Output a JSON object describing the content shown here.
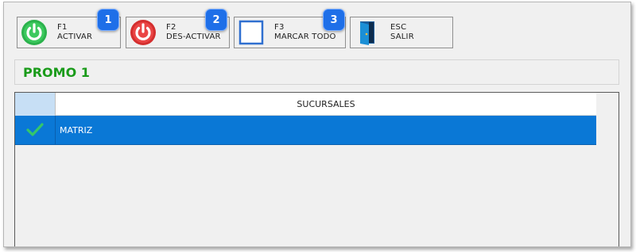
{
  "toolbar": {
    "activar": {
      "key": "F1",
      "label": "ACTIVAR",
      "icon": "power-green-icon",
      "color": "#2bb24c"
    },
    "desactivar": {
      "key": "F2",
      "label": "DES-ACTIVAR",
      "icon": "power-red-icon",
      "color": "#e03a3a"
    },
    "marcar": {
      "key": "F3",
      "label": "MARCAR TODO",
      "icon": "checkbox-empty-icon",
      "color": "#2f6fd0"
    },
    "salir": {
      "key": "ESC",
      "label": "SALIR",
      "icon": "door-exit-icon",
      "color": "#1b8fd6"
    }
  },
  "badges": [
    "1",
    "2",
    "3"
  ],
  "promo": {
    "title": "PROMO 1",
    "color": "#1a9b1a"
  },
  "grid": {
    "columns": [
      "SUCURSALES"
    ],
    "rows": [
      {
        "name": "MATRIZ",
        "checked": true
      }
    ],
    "selection_color": "#0a78d6"
  }
}
